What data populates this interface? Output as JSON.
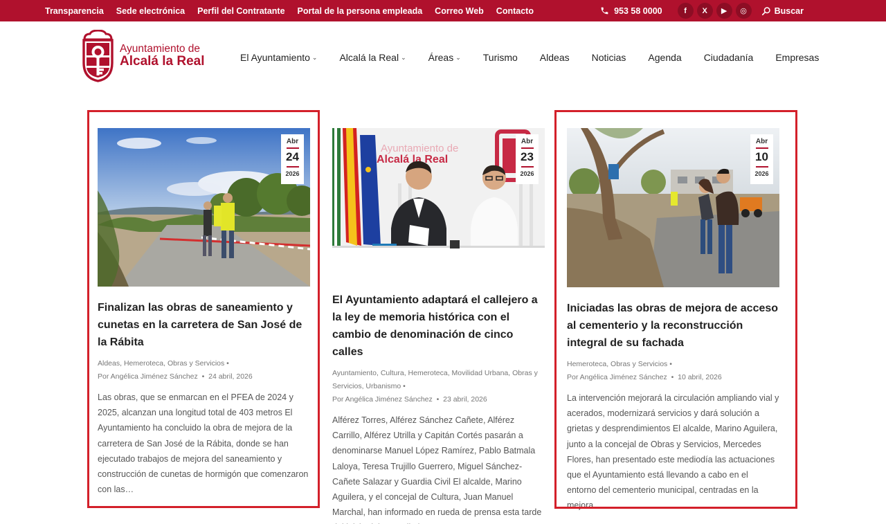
{
  "topbar": {
    "links": [
      "Transparencia",
      "Sede electrónica",
      "Perfil del Contratante",
      "Portal de la persona empleada",
      "Correo Web",
      "Contacto"
    ],
    "phone": "953 58 0000",
    "search_label": "Buscar",
    "social": [
      "f",
      "X",
      "▶",
      "◎"
    ]
  },
  "logo": {
    "line1": "Ayuntamiento de",
    "line2": "Alcalá la Real"
  },
  "nav": [
    {
      "label": "El Ayuntamiento",
      "dropdown": true
    },
    {
      "label": "Alcalá la Real",
      "dropdown": true
    },
    {
      "label": "Áreas",
      "dropdown": true
    },
    {
      "label": "Turismo",
      "dropdown": false
    },
    {
      "label": "Aldeas",
      "dropdown": false
    },
    {
      "label": "Noticias",
      "dropdown": false
    },
    {
      "label": "Agenda",
      "dropdown": false
    },
    {
      "label": "Ciudadanía",
      "dropdown": false
    },
    {
      "label": "Empresas",
      "dropdown": false
    }
  ],
  "colors": {
    "brand": "#b0112d",
    "highlight": "#d3202a"
  },
  "cards": [
    {
      "date": {
        "month": "Abr",
        "day": "24",
        "year": "2026"
      },
      "title": "Finalizan las obras de saneamiento y cunetas en la carretera de San José de la Rábita",
      "categories": "Aldeas, Hemeroteca, Obras y Servicios",
      "author": "Por Angélica Jiménez Sánchez",
      "pubdate": "24 abril, 2026",
      "excerpt": "Las obras, que se enmarcan en el PFEA de 2024 y 2025, alcanzan una longitud total de 403 metros El Ayuntamiento ha concluido la obra de mejora de la carretera de San José de la Rábita, donde se han ejecutado trabajos de mejora del saneamiento y construcción de cunetas de hormigón que comenzaron con las…",
      "highlighted": true
    },
    {
      "date": {
        "month": "Abr",
        "day": "23",
        "year": "2026"
      },
      "title": "El Ayuntamiento adaptará el callejero a la ley de memoria histórica con el cambio de denominación de cinco calles",
      "categories": "Ayuntamiento, Cultura, Hemeroteca, Movilidad Urbana, Obras y Servicios, Urbanismo",
      "author": "Por Angélica Jiménez Sánchez",
      "pubdate": "23 abril, 2026",
      "excerpt": "Alférez Torres, Alférez Sánchez Cañete, Alférez Carrillo, Alférez Utrilla y Capitán Cortés pasarán a denominarse Manuel López Ramírez, Pablo Batmala Laloya, Teresa Trujillo Guerrero, Miguel Sánchez-Cañete Salazar y Guardia Civil El alcalde, Marino Aguilera, y el concejal de Cultura, Juan Manuel Marchal, han informado en rueda de prensa esta tarde del inicio del procedimiento para…",
      "image_banner_line1": "Ayuntamiento de",
      "image_banner_line2": "Alcalá la Real",
      "highlighted": false
    },
    {
      "date": {
        "month": "Abr",
        "day": "10",
        "year": "2026"
      },
      "title": "Iniciadas las obras de mejora de acceso al cementerio y la reconstrucción integral de su fachada",
      "categories": "Hemeroteca, Obras y Servicios",
      "author": "Por Angélica Jiménez Sánchez",
      "pubdate": "10 abril, 2026",
      "excerpt": "La intervención mejorará la circulación ampliando vial y acerados, modernizará servicios y dará solución a grietas y desprendimientos El alcalde, Marino Aguilera, junto a la concejal de Obras y Servicios, Mercedes Flores, han presentado este mediodía las actuaciones que el Ayuntamiento está llevando a cabo en el entorno del cementerio municipal, centradas en la mejora…",
      "highlighted": true
    }
  ]
}
